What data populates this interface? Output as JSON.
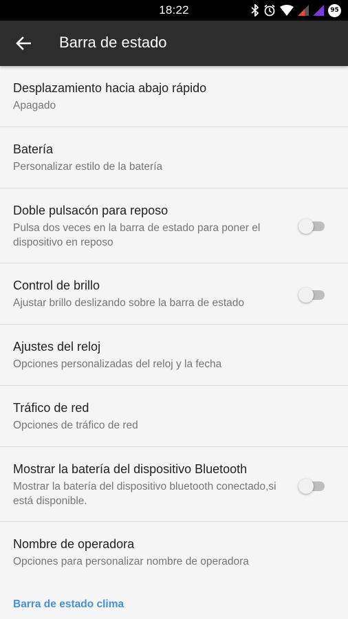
{
  "status_bar": {
    "time": "18:22",
    "icons": [
      "bluetooth-icon",
      "alarm-icon",
      "wifi-icon",
      "signal-sim1-icon",
      "signal-sim2-icon",
      "battery-icon"
    ],
    "battery_level": "95"
  },
  "app_bar": {
    "title": "Barra de estado",
    "back_icon": "arrow-back-icon"
  },
  "settings": [
    {
      "title": "Desplazamiento hacia abajo rápido",
      "summary": "Apagado"
    },
    {
      "title": "Batería",
      "summary": "Personalizar estilo de la batería"
    },
    {
      "title": "Doble pulsacón para reposo",
      "summary": "Pulsa dos veces en la barra de estado para poner el dispositivo en reposo",
      "toggle": false
    },
    {
      "title": "Control de brillo",
      "summary": "Ajustar brillo deslizando sobre la barra de estado",
      "toggle": false
    },
    {
      "title": "Ajustes del reloj",
      "summary": "Opciones personalizadas del reloj y la fecha"
    },
    {
      "title": "Tráfico de red",
      "summary": "Opciones de tráfico de red"
    },
    {
      "title": "Mostrar la batería del dispositivo Bluetooth",
      "summary": "Mostrar la batería del dispositivo bluetooth conectado,si está disponible.",
      "toggle": false
    },
    {
      "title": "Nombre de operadora",
      "summary": "Opciones para personalizar nombre de operadora"
    }
  ],
  "category_header": "Barra de estado clima",
  "colors": {
    "status_bar": "#000000",
    "app_bar": "#2d2d2d",
    "background": "#f5f5f5",
    "accent": "#4a90d9",
    "toggle_off_track": "#bdbdbd"
  }
}
